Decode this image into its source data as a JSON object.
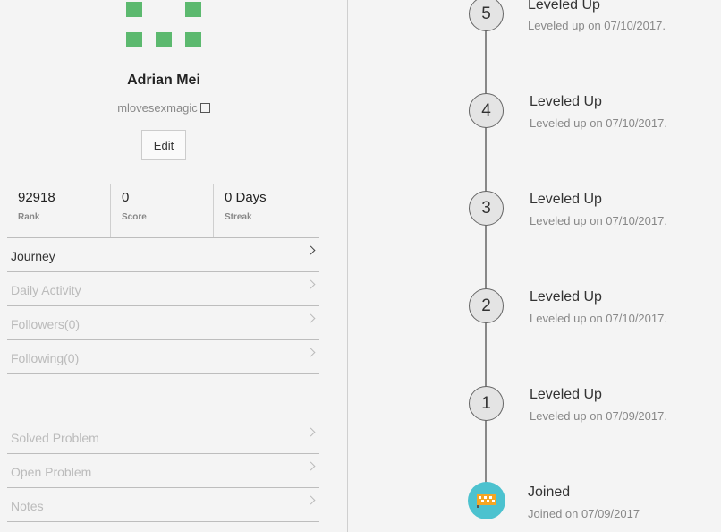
{
  "profile": {
    "name": "Adrian Mei",
    "handle": "mlovesexmagic",
    "edit_label": "Edit"
  },
  "stats": [
    {
      "value": "92918",
      "label": "Rank"
    },
    {
      "value": "0",
      "label": "Score"
    },
    {
      "value": "0 Days",
      "label": "Streak"
    }
  ],
  "menu": [
    {
      "label": "Journey",
      "active": true
    },
    {
      "label": "Daily Activity",
      "active": false
    },
    {
      "label": "Followers(0)",
      "active": false
    },
    {
      "label": "Following(0)",
      "active": false
    }
  ],
  "menu2": [
    {
      "label": "Solved Problem"
    },
    {
      "label": "Open Problem"
    },
    {
      "label": "Notes"
    }
  ],
  "timeline": [
    {
      "level": "5",
      "title": "Leveled Up",
      "date": "Leveled up on 07/10/2017."
    },
    {
      "level": "4",
      "title": "Leveled Up",
      "date": "Leveled up on 07/10/2017."
    },
    {
      "level": "3",
      "title": "Leveled Up",
      "date": "Leveled up on 07/10/2017."
    },
    {
      "level": "2",
      "title": "Leveled Up",
      "date": "Leveled up on 07/10/2017."
    },
    {
      "level": "1",
      "title": "Leveled Up",
      "date": "Leveled up on 07/09/2017."
    }
  ],
  "joined": {
    "title": "Joined",
    "date": "Joined on 07/09/2017"
  },
  "colors": {
    "avatar": "#5cb96f",
    "join_badge": "#4cc2cf",
    "flag": "#f5a623"
  }
}
